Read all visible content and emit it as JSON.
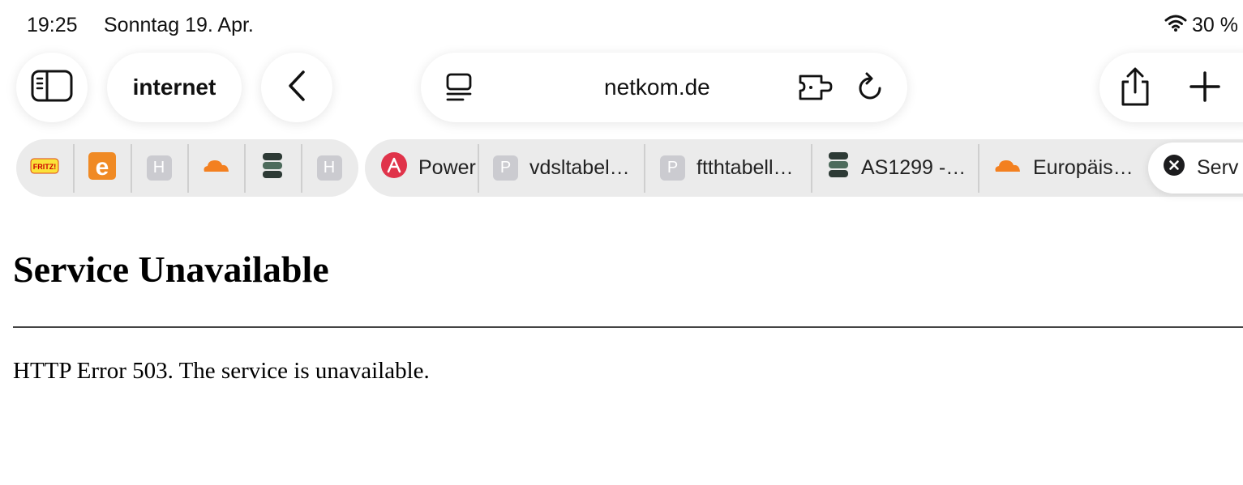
{
  "status_bar": {
    "time": "19:25",
    "date": "Sonntag 19. Apr.",
    "battery": "30 %",
    "wifi_icon": "wifi-icon"
  },
  "toolbar": {
    "sidebar_icon": "sidebar-icon",
    "tab_group_label": "internet",
    "back_icon": "chevron-left-icon",
    "address": {
      "url": "netkom.de",
      "reader_icon": "page-menu-icon",
      "extension_icon": "extension-icon",
      "reload_icon": "reload-icon"
    },
    "share_icon": "share-icon",
    "new_tab_icon": "plus-icon"
  },
  "pinned_tabs": [
    {
      "icon": "fritzbox-favicon",
      "label": "FRITZ!"
    },
    {
      "icon": "e-favicon",
      "label": "e"
    },
    {
      "icon": "h-favicon",
      "label": "H"
    },
    {
      "icon": "cloudflare-favicon"
    },
    {
      "icon": "server-stack-favicon"
    },
    {
      "icon": "h-favicon",
      "label": "H"
    }
  ],
  "tabs": [
    {
      "title": "Power",
      "icon": "power-favicon"
    },
    {
      "title": "vdsltabel…",
      "icon": "p-favicon",
      "letter": "P"
    },
    {
      "title": "ftthtabell…",
      "icon": "p-favicon",
      "letter": "P"
    },
    {
      "title": "AS1299 -…",
      "icon": "server-stack-favicon"
    },
    {
      "title": "Europäis…",
      "icon": "cloudflare-favicon"
    },
    {
      "title": "Serv",
      "icon": "close-icon",
      "active": true
    }
  ],
  "page": {
    "title": "Service Unavailable",
    "message": "HTTP Error 503. The service is unavailable."
  },
  "colors": {
    "pill_background": "#ffffff",
    "tab_bar_background": "#ebebeb",
    "cloudflare_orange": "#f38020",
    "power_red": "#e0334a",
    "e_orange": "#f08a24"
  }
}
